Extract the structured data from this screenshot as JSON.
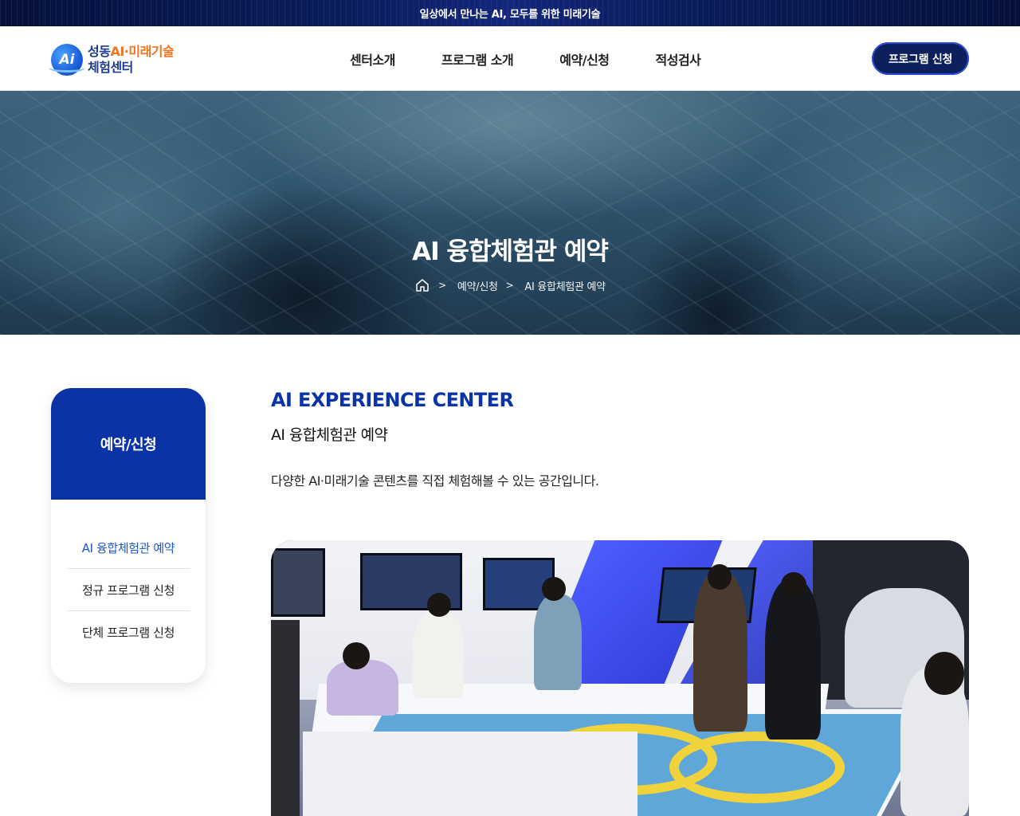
{
  "topbar": {
    "text": "일상에서 만나는 AI, 모두를 위한 미래기술"
  },
  "logo": {
    "mark": "Ai",
    "line1_prefix": "성동",
    "line1_highlight": "AI·미래기술",
    "line2": "체험센터"
  },
  "nav": {
    "items": [
      "센터소개",
      "프로그램 소개",
      "예약/신청",
      "적성검사"
    ],
    "cta": "프로그램 신청"
  },
  "hero": {
    "title": "AI 융합체험관 예약",
    "breadcrumb": {
      "home_icon": "home-icon",
      "separator": ">",
      "items": [
        "예약/신청",
        "AI 융합체험관 예약"
      ]
    }
  },
  "sidebar": {
    "title": "예약/신청",
    "items": [
      {
        "label": "AI 융합체험관 예약",
        "active": true
      },
      {
        "label": "정규 프로그램 신청",
        "active": false
      },
      {
        "label": "단체 프로그램 신청",
        "active": false
      }
    ]
  },
  "main": {
    "eyebrow": "AI EXPERIENCE CENTER",
    "subtitle": "AI 융합체험관 예약",
    "description": "다양한 AI·미래기술 콘텐츠를 직접 체험해볼 수 있는 공간입니다."
  },
  "colors": {
    "primary": "#0a33a6",
    "navy": "#0e1f5e",
    "accent_orange": "#f2731d",
    "active_link": "#1b56d6"
  }
}
